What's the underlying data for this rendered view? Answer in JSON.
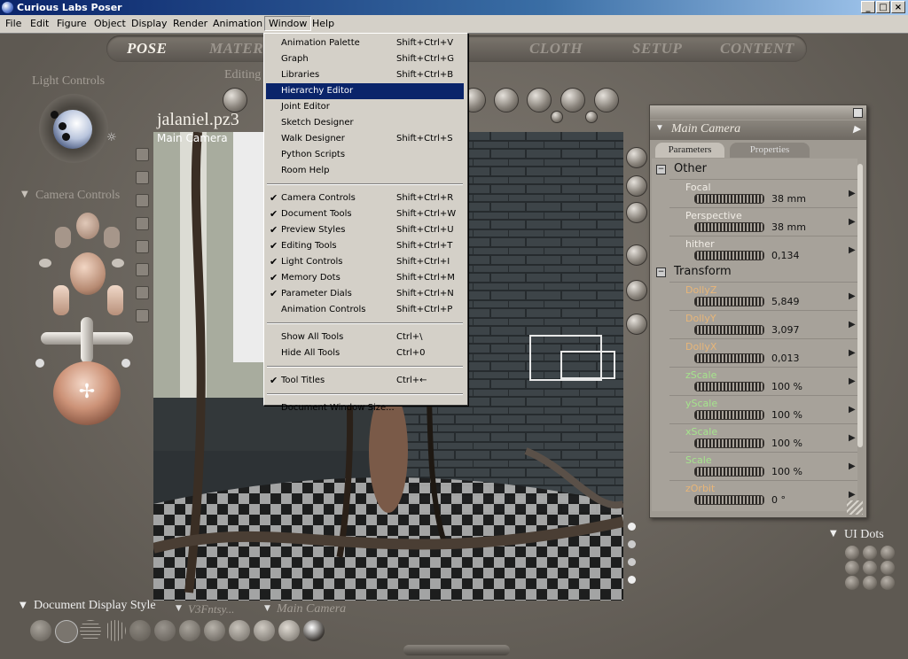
{
  "window": {
    "title": "Curious Labs Poser",
    "controls": [
      "_",
      "□",
      "×"
    ]
  },
  "menubar": {
    "items": [
      "File",
      "Edit",
      "Figure",
      "Object",
      "Display",
      "Render",
      "Animation",
      "Window",
      "Help"
    ],
    "open_menu": "Window"
  },
  "room_tabs": {
    "pose": "POSE",
    "material": "MATER",
    "cloth": "CLOTH",
    "setup": "SETUP",
    "content": "CONTENT"
  },
  "labels": {
    "light_controls": "Light Controls",
    "editing": "Editing",
    "camera_controls": "Camera Controls",
    "document_display_style": "Document Display Style",
    "v3_label": "V3Fntsy...",
    "main_camera_bottom": "Main Camera",
    "ui_dots": "UI Dots"
  },
  "document": {
    "title": "jalaniel.pz3",
    "camera": "Main Camera"
  },
  "window_menu": {
    "items": [
      {
        "label": "Animation Palette",
        "shortcut": "Shift+Ctrl+V",
        "checked": false
      },
      {
        "label": "Graph",
        "shortcut": "Shift+Ctrl+G",
        "checked": false
      },
      {
        "label": "Libraries",
        "shortcut": "Shift+Ctrl+B",
        "checked": false
      },
      {
        "label": "Hierarchy Editor",
        "shortcut": "",
        "checked": false,
        "highlighted": true
      },
      {
        "label": "Joint Editor",
        "shortcut": "",
        "checked": false
      },
      {
        "label": "Sketch Designer",
        "shortcut": "",
        "checked": false
      },
      {
        "label": "Walk Designer",
        "shortcut": "Shift+Ctrl+S",
        "checked": false
      },
      {
        "label": "Python Scripts",
        "shortcut": "",
        "checked": false
      },
      {
        "label": "Room Help",
        "shortcut": "",
        "checked": false
      },
      {
        "label": "Camera Controls",
        "shortcut": "Shift+Ctrl+R",
        "checked": true
      },
      {
        "label": "Document Tools",
        "shortcut": "Shift+Ctrl+W",
        "checked": true
      },
      {
        "label": "Preview Styles",
        "shortcut": "Shift+Ctrl+U",
        "checked": true
      },
      {
        "label": "Editing Tools",
        "shortcut": "Shift+Ctrl+T",
        "checked": true
      },
      {
        "label": "Light Controls",
        "shortcut": "Shift+Ctrl+I",
        "checked": true
      },
      {
        "label": "Memory Dots",
        "shortcut": "Shift+Ctrl+M",
        "checked": true
      },
      {
        "label": "Parameter Dials",
        "shortcut": "Shift+Ctrl+N",
        "checked": true
      },
      {
        "label": "Animation Controls",
        "shortcut": "Shift+Ctrl+P",
        "checked": false
      },
      {
        "label": "Show All Tools",
        "shortcut": "Ctrl+\\",
        "checked": false
      },
      {
        "label": "Hide All Tools",
        "shortcut": "Ctrl+0",
        "checked": false
      },
      {
        "label": "Tool Titles",
        "shortcut": "Ctrl+←",
        "checked": true
      },
      {
        "label": "Document Window Size...",
        "shortcut": "",
        "checked": false
      }
    ]
  },
  "parameters_palette": {
    "camera": "Main Camera",
    "tabs": [
      "Parameters",
      "Properties"
    ],
    "groups": [
      {
        "name": "Other",
        "params": [
          {
            "name": "Focal",
            "value": "38 mm",
            "color": "white"
          },
          {
            "name": "Perspective",
            "value": "38 mm",
            "color": "white"
          },
          {
            "name": "hither",
            "value": "0,134",
            "color": "white"
          }
        ]
      },
      {
        "name": "Transform",
        "params": [
          {
            "name": "DollyZ",
            "value": "5,849",
            "color": "orange"
          },
          {
            "name": "DollyY",
            "value": "3,097",
            "color": "orange"
          },
          {
            "name": "DollyX",
            "value": "0,013",
            "color": "orange"
          },
          {
            "name": "zScale",
            "value": "100 %",
            "color": "green"
          },
          {
            "name": "yScale",
            "value": "100 %",
            "color": "green"
          },
          {
            "name": "xScale",
            "value": "100 %",
            "color": "green"
          },
          {
            "name": "Scale",
            "value": "100 %",
            "color": "green"
          },
          {
            "name": "zOrbit",
            "value": "0 °",
            "color": "orange"
          }
        ]
      }
    ]
  },
  "colors": {
    "menu_highlight": "#0a246a",
    "param_white": "#f1ede6",
    "param_orange": "#e7b578",
    "param_green": "#a5e48c"
  }
}
